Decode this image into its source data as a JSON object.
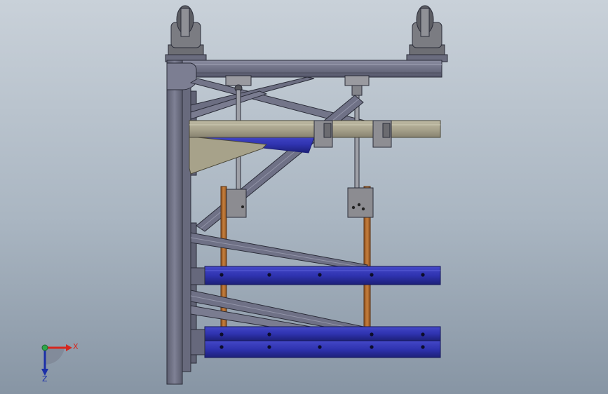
{
  "view": {
    "axes": {
      "x_label": "X",
      "z_label": "Z",
      "x_color": "#d6271e",
      "z_color": "#1b2fa8",
      "origin_color": "#2ea84a"
    },
    "colors": {
      "frame_steel": "#6f7185",
      "frame_steel_light": "#8d8fa3",
      "frame_edge": "#2a2c38",
      "beam_tan": "#a9a48d",
      "blue_channel": "#2f33b0",
      "blue_channel_dark": "#1d2078",
      "copper_rod": "#b06a2e",
      "bracket_grey": "#8a8a8f",
      "caster_grey": "#77787d"
    }
  }
}
